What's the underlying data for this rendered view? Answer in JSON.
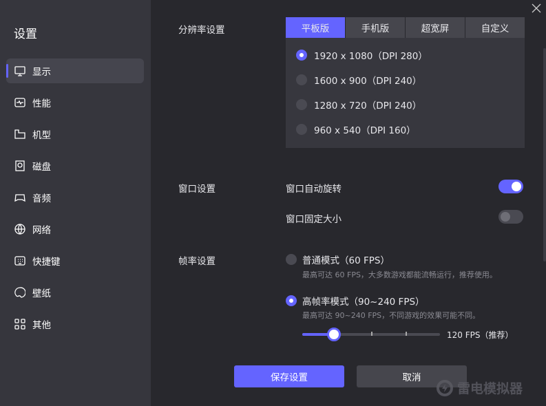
{
  "sidebar": {
    "title": "设置",
    "items": [
      {
        "label": "显示",
        "icon": "monitor-icon"
      },
      {
        "label": "性能",
        "icon": "performance-icon"
      },
      {
        "label": "机型",
        "icon": "device-icon"
      },
      {
        "label": "磁盘",
        "icon": "disk-icon"
      },
      {
        "label": "音频",
        "icon": "gamepad-icon"
      },
      {
        "label": "网络",
        "icon": "globe-icon"
      },
      {
        "label": "快捷键",
        "icon": "keyboard-icon"
      },
      {
        "label": "壁纸",
        "icon": "palette-icon"
      },
      {
        "label": "其他",
        "icon": "grid-icon"
      }
    ]
  },
  "resolution": {
    "label": "分辨率设置",
    "tabs": [
      "平板版",
      "手机版",
      "超宽屏",
      "自定义"
    ],
    "options": [
      "1920 x 1080（DPI 280）",
      "1600 x 900（DPI 240）",
      "1280 x 720（DPI 240）",
      "960 x 540（DPI 160）"
    ],
    "selected": 0
  },
  "window": {
    "label": "窗口设置",
    "auto_rotate": "窗口自动旋转",
    "auto_rotate_on": true,
    "fixed_size": "窗口固定大小",
    "fixed_size_on": false
  },
  "framerate": {
    "label": "帧率设置",
    "normal": "普通模式（60 FPS）",
    "normal_desc": "最高可达 60 FPS，大多数游戏都能流畅运行，推荐使用。",
    "high": "高帧率模式（90~240 FPS）",
    "high_desc": "最高可达 90~240 FPS，不同游戏的效果可能不同。",
    "slider_value_label": "120 FPS（推荐）",
    "slider_min": 90,
    "slider_max": 240,
    "slider_value": 120
  },
  "buttons": {
    "save": "保存设置",
    "cancel": "取消"
  },
  "brand": "雷电模拟器",
  "colors": {
    "accent": "#6464ff"
  }
}
